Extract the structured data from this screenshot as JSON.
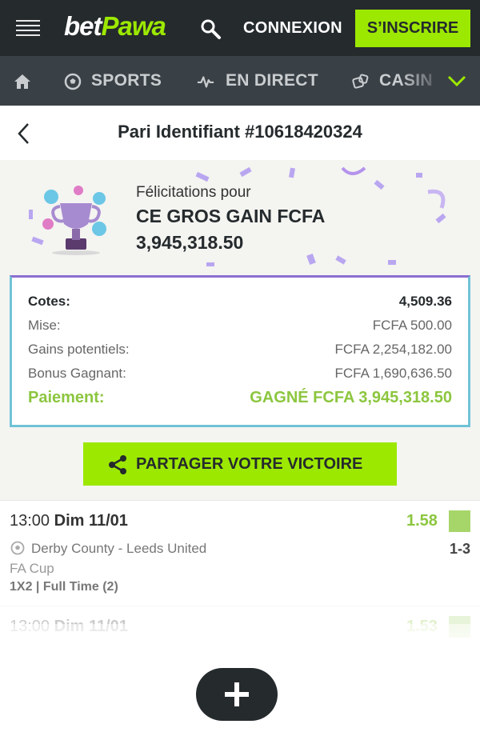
{
  "header": {
    "logo_part1": "bet",
    "logo_part2": "Pawa",
    "login_label": "CONNEXION",
    "signup_label": "S’INSCRIRE"
  },
  "nav": {
    "items": [
      {
        "label": "SPORTS",
        "icon": "soccer-ball-icon"
      },
      {
        "label": "EN DIRECT",
        "icon": "pulse-icon"
      },
      {
        "label": "CASIN",
        "icon": "dice-icon"
      }
    ]
  },
  "page": {
    "title": "Pari Identifiant #10618420324"
  },
  "win": {
    "congrats": "Félicitations pour",
    "headline": "CE GROS GAIN FCFA",
    "amount": "3,945,318.50"
  },
  "summary": {
    "odds_label": "Cotes:",
    "odds_value": "4,509.36",
    "stake_label": "Mise:",
    "stake_value": "FCFA 500.00",
    "potential_label": "Gains potentiels:",
    "potential_value": "FCFA 2,254,182.00",
    "bonus_label": "Bonus Gagnant:",
    "bonus_value": "FCFA 1,690,636.50",
    "payout_label": "Paiement:",
    "payout_value": "GAGNÉ FCFA 3,945,318.50"
  },
  "share": {
    "label": "PARTAGER VOTRE VICTOIRE"
  },
  "events": [
    {
      "time": "13:00",
      "date": "Dim 11/01",
      "odd": "1.58",
      "teams": "Derby County - Leeds United",
      "score": "1-3",
      "league": "FA Cup",
      "market": "1X2 | Full Time (2)"
    },
    {
      "time": "13:00",
      "date": "Dim 11/01",
      "odd": "1.53"
    }
  ],
  "colors": {
    "brand_green": "#9ce800",
    "dark": "#252a2d",
    "win_green": "#8cc63f"
  }
}
